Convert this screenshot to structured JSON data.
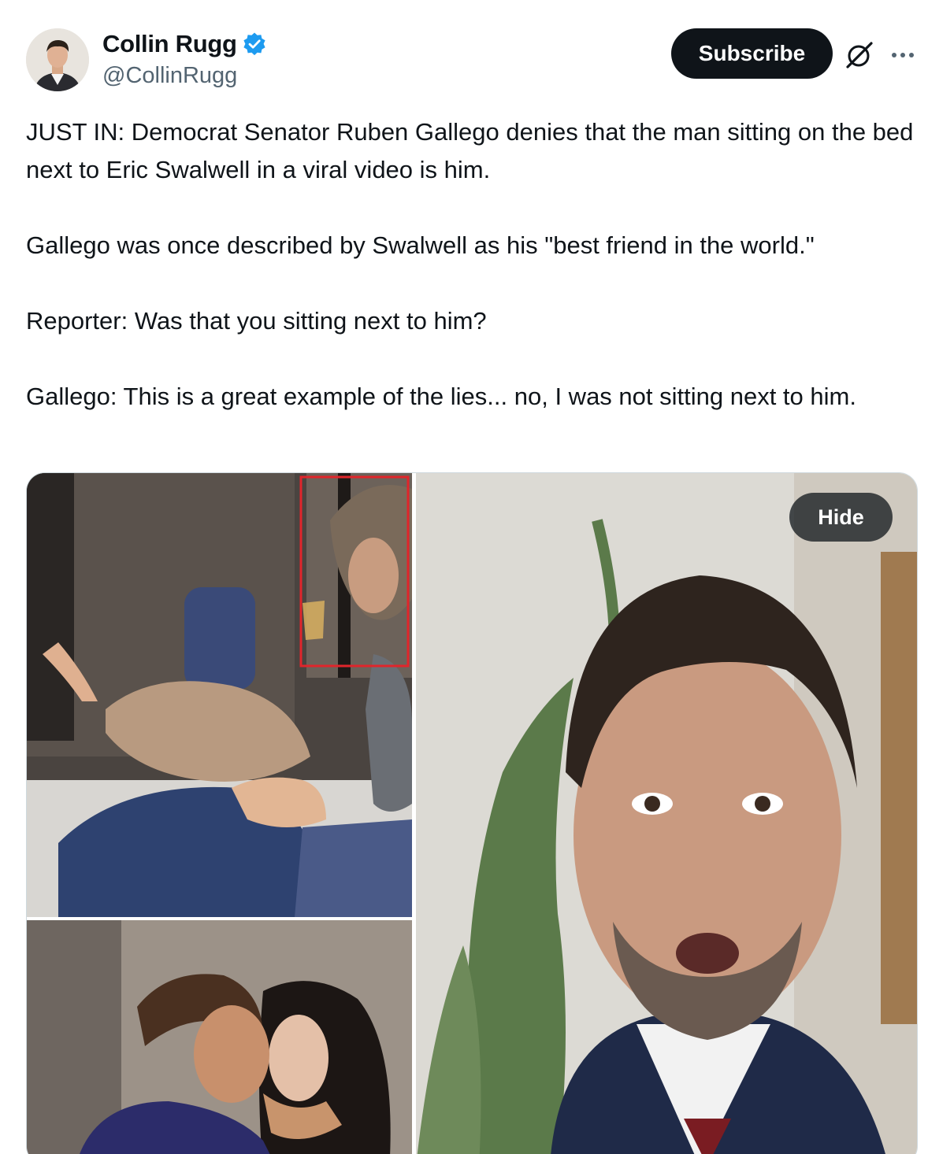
{
  "author": {
    "display_name": "Collin Rugg",
    "handle": "@CollinRugg",
    "verified": true,
    "avatar_icon": "user-avatar-photo"
  },
  "actions": {
    "subscribe_label": "Subscribe",
    "grok_icon": "grok-icon",
    "more_icon": "more-horizontal-icon"
  },
  "tweet": {
    "paragraphs": [
      "JUST IN: Democrat Senator Ruben Gallego denies that the man sitting on the bed next to Eric Swalwell in a viral video is him.",
      "Gallego was once described by Swalwell as his \"best friend in the world.\"",
      "Reporter: Was that you sitting next to him?",
      "Gallego: This is a great example of the lies... no, I was not sitting next to him."
    ]
  },
  "media": {
    "hide_label": "Hide",
    "images": [
      "photo-bedroom-highlighted",
      "photo-couple-kissing",
      "photo-senator-closeup"
    ]
  },
  "colors": {
    "text": "#0f1419",
    "secondary": "#536471",
    "verified_blue": "#1d9bf0",
    "border": "#cfd9de",
    "highlight_box": "#e0252b"
  }
}
